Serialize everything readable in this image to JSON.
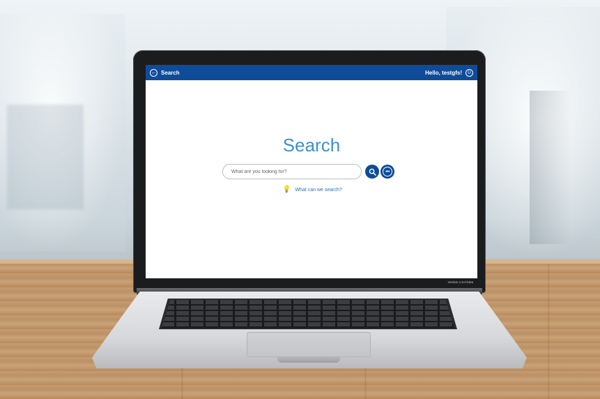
{
  "header": {
    "title": "Search",
    "greeting": "Hello, testgfs!",
    "back_icon": "back-arrow-icon",
    "avatar_icon": "user-circle-icon",
    "bg_color": "#0e4c9a"
  },
  "main": {
    "title": "Search",
    "search_placeholder": "What are you looking for?",
    "search_button_icon": "search-icon",
    "more_button_icon": "more-options-icon",
    "hint_icon": "lightbulb-icon",
    "hint_text": "What can we search?"
  },
  "footer": {
    "version": "Version 1.0.0-beta"
  },
  "colors": {
    "accent": "#3f8fd0",
    "brand": "#0e4c9a"
  }
}
